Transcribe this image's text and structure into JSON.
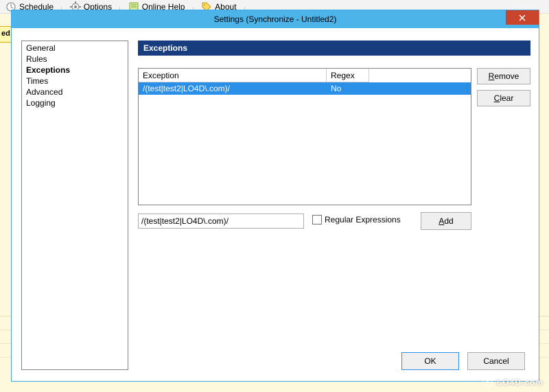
{
  "main_menu": {
    "schedule": "Schedule",
    "options": "Options",
    "online_help": "Online Help",
    "about": "About"
  },
  "under_tab_text": "ed",
  "dialog": {
    "title": "Settings (Synchronize - Untitled2)",
    "nav": [
      {
        "label": "General",
        "active": false
      },
      {
        "label": "Rules",
        "active": false
      },
      {
        "label": "Exceptions",
        "active": true
      },
      {
        "label": "Times",
        "active": false
      },
      {
        "label": "Advanced",
        "active": false
      },
      {
        "label": "Logging",
        "active": false
      }
    ],
    "section_header": "Exceptions",
    "columns": {
      "exception": "Exception",
      "regex": "Regex"
    },
    "rows": [
      {
        "exception": "/(test|test2|LO4D\\.com)/",
        "regex": "No",
        "selected": true
      }
    ],
    "buttons": {
      "remove": "Remove",
      "clear": "Clear",
      "add": "Add",
      "ok": "OK",
      "cancel": "Cancel"
    },
    "input_value": "/(test|test2|LO4D\\.com)/",
    "regex_checkbox": {
      "label": "Regular Expressions",
      "checked": false
    }
  },
  "watermark": "LO4D.com"
}
